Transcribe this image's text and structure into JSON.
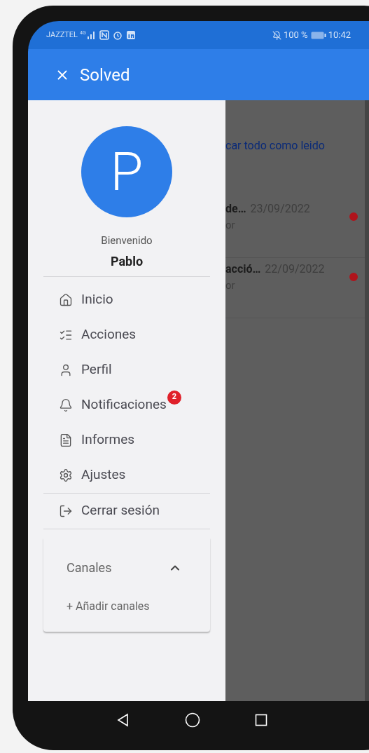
{
  "status_bar": {
    "carrier": "JAZZTEL",
    "network": "4G",
    "battery": "100 %",
    "time": "10:42"
  },
  "app_bar": {
    "title": "Solved"
  },
  "drawer": {
    "avatar_initial": "P",
    "greeting": "Bienvenido",
    "user_name": "Pablo",
    "items": [
      {
        "label": "Inicio",
        "kind": "home"
      },
      {
        "label": "Acciones",
        "kind": "checklist"
      },
      {
        "label": "Perfil",
        "kind": "user"
      },
      {
        "label": "Notificaciones",
        "kind": "bell",
        "badge": "2"
      },
      {
        "label": "Informes",
        "kind": "document"
      },
      {
        "label": "Ajustes",
        "kind": "gear"
      }
    ],
    "logout": {
      "label": "Cerrar sesión"
    },
    "channels": {
      "title": "Canales",
      "expanded": true,
      "add_label": "+ Añadir canales"
    }
  },
  "background": {
    "mark_all": "car todo como leido",
    "notifications": [
      {
        "title": "de…",
        "subtitle": "or",
        "date": "23/09/2022",
        "unread": true
      },
      {
        "title": "acció…",
        "subtitle": "or",
        "date": "22/09/2022",
        "unread": true
      }
    ]
  }
}
